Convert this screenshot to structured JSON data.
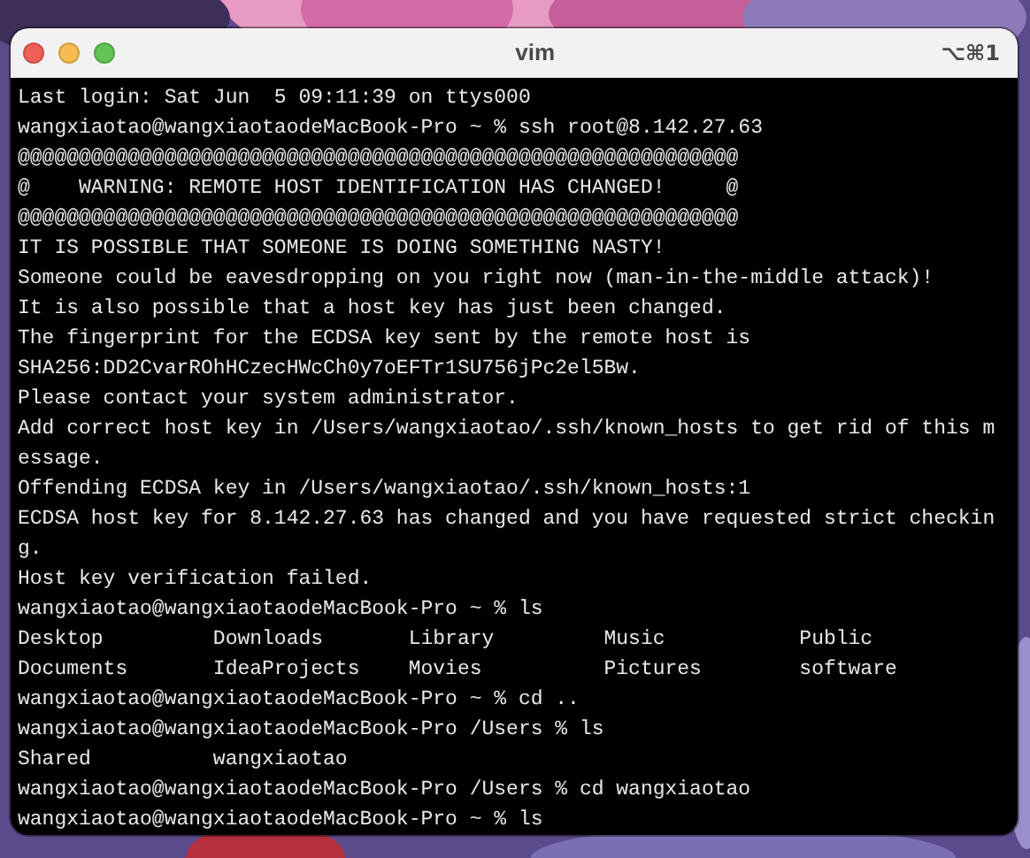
{
  "window": {
    "title": "vim",
    "shortcut": "⌥⌘1",
    "buttons": [
      {
        "kind": "close"
      },
      {
        "kind": "minimize"
      },
      {
        "kind": "zoom"
      }
    ]
  },
  "terminal": {
    "lines": [
      "Last login: Sat Jun  5 09:11:39 on ttys000",
      "wangxiaotao@wangxiaotaodeMacBook-Pro ~ % ssh root@8.142.27.63",
      "@@@@@@@@@@@@@@@@@@@@@@@@@@@@@@@@@@@@@@@@@@@@@@@@@@@@@@@@@@@",
      "@    WARNING: REMOTE HOST IDENTIFICATION HAS CHANGED!     @",
      "@@@@@@@@@@@@@@@@@@@@@@@@@@@@@@@@@@@@@@@@@@@@@@@@@@@@@@@@@@@",
      "IT IS POSSIBLE THAT SOMEONE IS DOING SOMETHING NASTY!",
      "Someone could be eavesdropping on you right now (man-in-the-middle attack)!",
      "It is also possible that a host key has just been changed.",
      "The fingerprint for the ECDSA key sent by the remote host is",
      "SHA256:DD2CvarROhHCzecHWcCh0y7oEFTr1SU756jPc2el5Bw.",
      "Please contact your system administrator.",
      "Add correct host key in /Users/wangxiaotao/.ssh/known_hosts to get rid of this m",
      "essage.",
      "Offending ECDSA key in /Users/wangxiaotao/.ssh/known_hosts:1",
      "ECDSA host key for 8.142.27.63 has changed and you have requested strict checkin",
      "g.",
      "Host key verification failed.",
      "wangxiaotao@wangxiaotaodeMacBook-Pro ~ % ls",
      "Desktop         Downloads       Library         Music           Public",
      "Documents       IdeaProjects    Movies          Pictures        software",
      "wangxiaotao@wangxiaotaodeMacBook-Pro ~ % cd ..",
      "wangxiaotao@wangxiaotaodeMacBook-Pro /Users % ls",
      "Shared          wangxiaotao",
      "wangxiaotao@wangxiaotaodeMacBook-Pro /Users % cd wangxiaotao",
      "wangxiaotao@wangxiaotaodeMacBook-Pro ~ % ls"
    ]
  }
}
